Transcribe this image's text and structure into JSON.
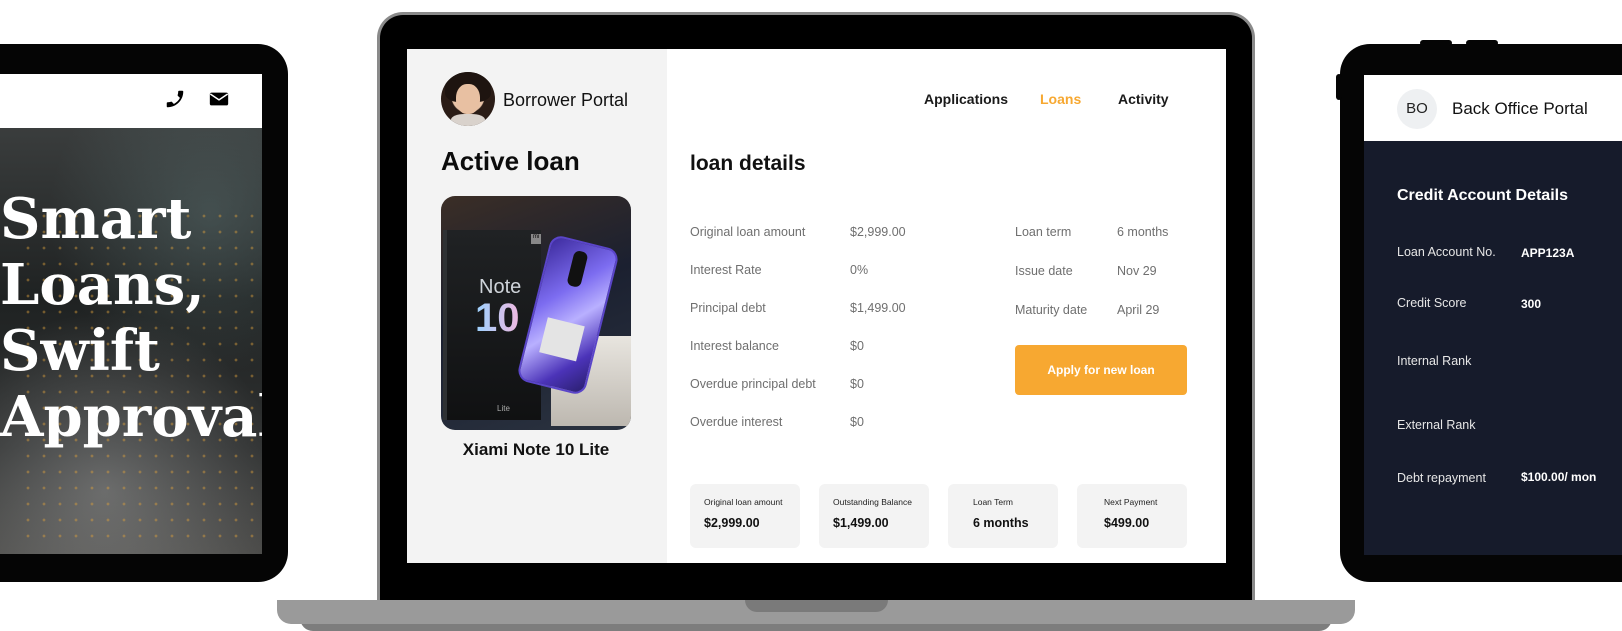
{
  "left_tablet": {
    "hero_title": "Smart\nLoans,\nSwift\nApproval",
    "icons": [
      "phone-icon",
      "envelope-icon"
    ]
  },
  "borrower_portal": {
    "portal_name": "Borrower Portal",
    "nav": [
      {
        "label": "Applications",
        "active": false
      },
      {
        "label": "Loans",
        "active": true
      },
      {
        "label": "Activity",
        "active": false
      }
    ],
    "active_loan_title": "Active loan",
    "product_name": "Xiami Note 10 Lite",
    "product_box_text": {
      "note": "Note",
      "ten": "10",
      "lite": "Lite"
    },
    "loan_details_title": "loan details",
    "details_left": [
      {
        "label": "Original loan amount",
        "value": "$2,999.00"
      },
      {
        "label": "Interest Rate",
        "value": "0%"
      },
      {
        "label": "Principal debt",
        "value": "$1,499.00"
      },
      {
        "label": "Interest balance",
        "value": "$0"
      },
      {
        "label": "Overdue principal debt",
        "value": "$0"
      },
      {
        "label": "Overdue interest",
        "value": "$0"
      }
    ],
    "details_right": [
      {
        "label": "Loan term",
        "value": "6 months"
      },
      {
        "label": "Issue date",
        "value": "Nov 29"
      },
      {
        "label": "Maturity date",
        "value": "April 29"
      }
    ],
    "apply_button": "Apply for new loan",
    "summary_cards": [
      {
        "label": "Original loan amount",
        "value": "$2,999.00"
      },
      {
        "label": "Outstanding Balance",
        "value": "$1,499.00"
      },
      {
        "label": "Loan Term",
        "value": "6 months"
      },
      {
        "label": "Next Payment",
        "value": "$499.00"
      }
    ],
    "accent_color": "#f7a831"
  },
  "back_office": {
    "avatar_initials": "BO",
    "title": "Back Office Portal",
    "section_title": "Credit Account Details",
    "rows": [
      {
        "label": "Loan Account No.",
        "value": "APP123A"
      },
      {
        "label": "Credit Score",
        "value": "300"
      },
      {
        "label": "Internal Rank",
        "value": ""
      },
      {
        "label": "External Rank",
        "value": ""
      },
      {
        "label": "Debt repayment",
        "value": "$100.00/ mon"
      }
    ],
    "background_color": "#161b2b"
  }
}
